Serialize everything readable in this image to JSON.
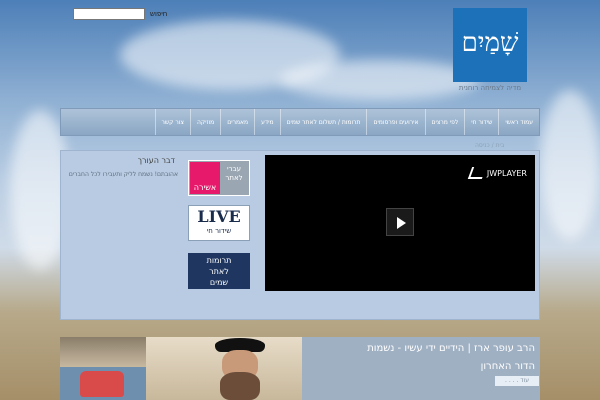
{
  "header": {
    "search_label": "חיפוש",
    "logo_text": "שָׁמַיִם",
    "tagline": "מדיה לצמיחה רוחנית",
    "colors": {
      "logo": "#1d71b8",
      "nav": "#8aa6c4"
    }
  },
  "nav": {
    "items": [
      "עמוד ראשי",
      "שידור חי",
      "לפי מרצים",
      "אירועים ופרסומים",
      "תרומות / תשלום לאתר שמים",
      "מידע",
      "מאמרים",
      "מוזיקה",
      "צור קשר"
    ]
  },
  "breadcrumb": "בית / כניסה",
  "player": {
    "brand": "JWPLAYER",
    "play_icon": "play-icon"
  },
  "editor": {
    "heading": "דבר העורך",
    "text": "אהובתם! נשמח לליק ותעבירו לכל החברים"
  },
  "promos": {
    "ashira_top": "עברי לאתר",
    "ashira_label": "אשירה",
    "live_en": "LIVE",
    "live_he": "שידור חי",
    "donate_1": "תרומות",
    "donate_2": "לאתר",
    "donate_3": "שמים"
  },
  "featured": {
    "line1": "הרב עופר ארז | הידיים ידי עשיו - נשמות",
    "line2": "הדור האחרון",
    "more": "עוד . . . ."
  }
}
